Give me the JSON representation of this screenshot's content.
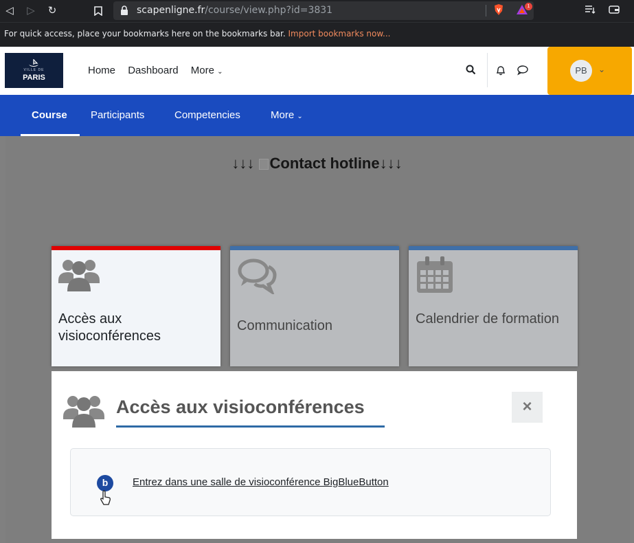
{
  "browser": {
    "url_host": "scapenligne.fr",
    "url_path": "/course/view.php?id=3831",
    "bat_badge": "1",
    "bookmarks_text": "For quick access, place your bookmarks here on the bookmarks bar.",
    "bookmarks_link": "Import bookmarks now..."
  },
  "header": {
    "logo_sub": "VILLE DE",
    "logo_text": "PARIS",
    "nav": [
      "Home",
      "Dashboard",
      "More"
    ],
    "avatar_initials": "PB"
  },
  "secondary_nav": [
    "Course",
    "Participants",
    "Competencies",
    "More"
  ],
  "content": {
    "hotline_prefix": "↓↓↓",
    "hotline_text": "Contact hotline",
    "hotline_suffix": "↓↓↓",
    "tiles": [
      {
        "label": "Accès aux visioconférences",
        "icon": "users-icon",
        "active": true
      },
      {
        "label": "Communication",
        "icon": "comments-icon",
        "active": false
      },
      {
        "label": "Calendrier de formation",
        "icon": "calendar-icon",
        "active": false
      }
    ]
  },
  "panel": {
    "title": "Accès aux visioconférences",
    "close_label": "×",
    "activity_icon_letter": "b",
    "activity_link": "Entrez dans une salle de visioconférence BigBlueButton"
  },
  "colors": {
    "secondary_nav_bg": "#1a4bbf",
    "user_menu_bg": "#f7a800",
    "active_tile_bar": "#e00000",
    "tile_bar": "#3f6fa8"
  }
}
